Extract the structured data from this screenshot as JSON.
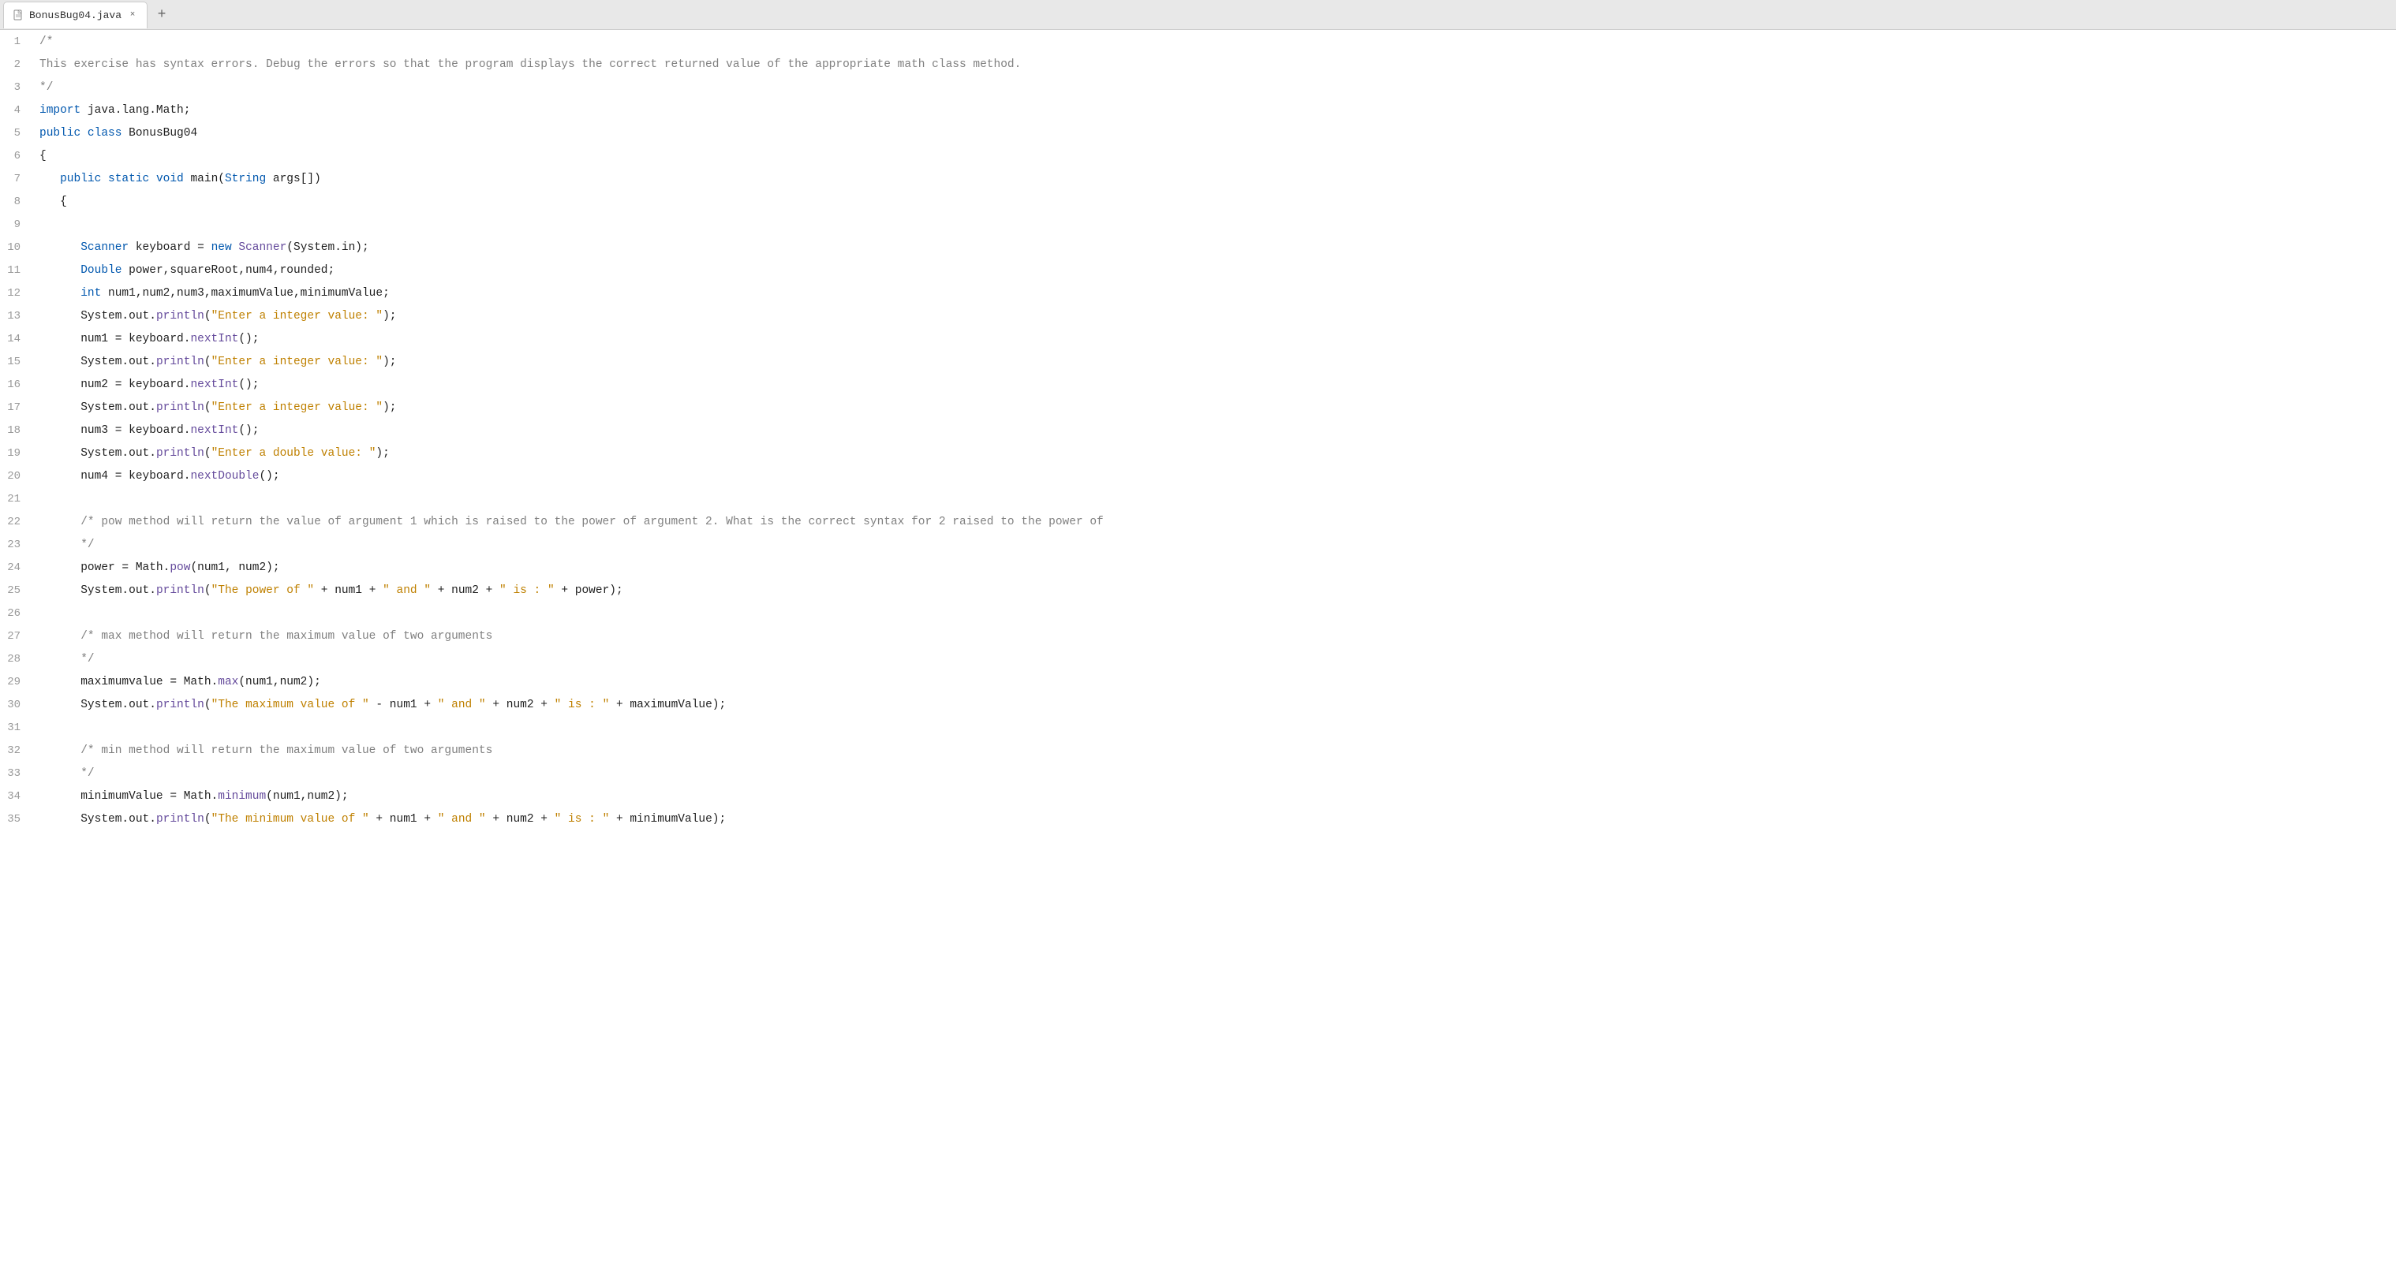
{
  "tab": {
    "filename": "BonusBug04.java",
    "add_label": "+"
  },
  "code": {
    "lines": [
      {
        "num": 1,
        "tokens": [
          {
            "t": "cm",
            "v": "/*"
          }
        ]
      },
      {
        "num": 2,
        "tokens": [
          {
            "t": "cm",
            "v": "This exercise has syntax errors. Debug the errors so that the program displays the correct returned value of the appropriate math class method."
          }
        ]
      },
      {
        "num": 3,
        "tokens": [
          {
            "t": "cm",
            "v": "*/"
          }
        ]
      },
      {
        "num": 4,
        "tokens": [
          {
            "t": "kw",
            "v": "import"
          },
          {
            "t": "plain",
            "v": " java.lang.Math;"
          }
        ]
      },
      {
        "num": 5,
        "tokens": [
          {
            "t": "kw",
            "v": "public"
          },
          {
            "t": "plain",
            "v": " "
          },
          {
            "t": "kw",
            "v": "class"
          },
          {
            "t": "plain",
            "v": " BonusBug04"
          }
        ]
      },
      {
        "num": 6,
        "tokens": [
          {
            "t": "plain",
            "v": "{"
          }
        ]
      },
      {
        "num": 7,
        "tokens": [
          {
            "t": "plain",
            "v": "   "
          },
          {
            "t": "kw",
            "v": "public"
          },
          {
            "t": "plain",
            "v": " "
          },
          {
            "t": "kw",
            "v": "static"
          },
          {
            "t": "plain",
            "v": " "
          },
          {
            "t": "kw",
            "v": "void"
          },
          {
            "t": "plain",
            "v": " main("
          },
          {
            "t": "type",
            "v": "String"
          },
          {
            "t": "plain",
            "v": " args[])"
          }
        ]
      },
      {
        "num": 8,
        "tokens": [
          {
            "t": "plain",
            "v": "   {"
          }
        ]
      },
      {
        "num": 9,
        "tokens": []
      },
      {
        "num": 10,
        "tokens": [
          {
            "t": "plain",
            "v": "      "
          },
          {
            "t": "type",
            "v": "Scanner"
          },
          {
            "t": "plain",
            "v": " keyboard = "
          },
          {
            "t": "kw",
            "v": "new"
          },
          {
            "t": "plain",
            "v": " "
          },
          {
            "t": "fn",
            "v": "Scanner"
          },
          {
            "t": "plain",
            "v": "(System.in);"
          }
        ]
      },
      {
        "num": 11,
        "tokens": [
          {
            "t": "plain",
            "v": "      "
          },
          {
            "t": "type",
            "v": "Double"
          },
          {
            "t": "plain",
            "v": " power,squareRoot,num4,rounded;"
          }
        ]
      },
      {
        "num": 12,
        "tokens": [
          {
            "t": "plain",
            "v": "      "
          },
          {
            "t": "kw",
            "v": "int"
          },
          {
            "t": "plain",
            "v": " num1,num2,num3,maximumValue,minimumValue;"
          }
        ]
      },
      {
        "num": 13,
        "tokens": [
          {
            "t": "plain",
            "v": "      System.out."
          },
          {
            "t": "fn",
            "v": "println"
          },
          {
            "t": "plain",
            "v": "("
          },
          {
            "t": "st",
            "v": "\"Enter a integer value: \""
          },
          {
            "t": "plain",
            "v": ");"
          }
        ]
      },
      {
        "num": 14,
        "tokens": [
          {
            "t": "plain",
            "v": "      num1 = keyboard."
          },
          {
            "t": "fn",
            "v": "nextInt"
          },
          {
            "t": "plain",
            "v": "();"
          }
        ]
      },
      {
        "num": 15,
        "tokens": [
          {
            "t": "plain",
            "v": "      System.out."
          },
          {
            "t": "fn",
            "v": "println"
          },
          {
            "t": "plain",
            "v": "("
          },
          {
            "t": "st",
            "v": "\"Enter a integer value: \""
          },
          {
            "t": "plain",
            "v": ");"
          }
        ]
      },
      {
        "num": 16,
        "tokens": [
          {
            "t": "plain",
            "v": "      num2 = keyboard."
          },
          {
            "t": "fn",
            "v": "nextInt"
          },
          {
            "t": "plain",
            "v": "();"
          }
        ]
      },
      {
        "num": 17,
        "tokens": [
          {
            "t": "plain",
            "v": "      System.out."
          },
          {
            "t": "fn",
            "v": "println"
          },
          {
            "t": "plain",
            "v": "("
          },
          {
            "t": "st",
            "v": "\"Enter a integer value: \""
          },
          {
            "t": "plain",
            "v": ");"
          }
        ]
      },
      {
        "num": 18,
        "tokens": [
          {
            "t": "plain",
            "v": "      num3 = keyboard."
          },
          {
            "t": "fn",
            "v": "nextInt"
          },
          {
            "t": "plain",
            "v": "();"
          }
        ]
      },
      {
        "num": 19,
        "tokens": [
          {
            "t": "plain",
            "v": "      System.out."
          },
          {
            "t": "fn",
            "v": "println"
          },
          {
            "t": "plain",
            "v": "("
          },
          {
            "t": "st",
            "v": "\"Enter a double value: \""
          },
          {
            "t": "plain",
            "v": ");"
          }
        ]
      },
      {
        "num": 20,
        "tokens": [
          {
            "t": "plain",
            "v": "      num4 = keyboard."
          },
          {
            "t": "fn",
            "v": "nextDouble"
          },
          {
            "t": "plain",
            "v": "();"
          }
        ]
      },
      {
        "num": 21,
        "tokens": []
      },
      {
        "num": 22,
        "tokens": [
          {
            "t": "plain",
            "v": "      "
          },
          {
            "t": "cm",
            "v": "/* pow method will return the value of argument 1 which is raised to the power of argument 2. What is the correct syntax for 2 raised to the power of"
          }
        ]
      },
      {
        "num": 23,
        "tokens": [
          {
            "t": "plain",
            "v": "      "
          },
          {
            "t": "cm",
            "v": "*/"
          }
        ]
      },
      {
        "num": 24,
        "tokens": [
          {
            "t": "plain",
            "v": "      power = Math."
          },
          {
            "t": "fn",
            "v": "pow"
          },
          {
            "t": "plain",
            "v": "(num1, num2);"
          }
        ]
      },
      {
        "num": 25,
        "tokens": [
          {
            "t": "plain",
            "v": "      System.out."
          },
          {
            "t": "fn",
            "v": "println"
          },
          {
            "t": "plain",
            "v": "("
          },
          {
            "t": "st",
            "v": "\"The power of \""
          },
          {
            "t": "plain",
            "v": " + num1 + "
          },
          {
            "t": "st",
            "v": "\" and \""
          },
          {
            "t": "plain",
            "v": " + num2 + "
          },
          {
            "t": "st",
            "v": "\" is : \""
          },
          {
            "t": "plain",
            "v": " + power);"
          }
        ]
      },
      {
        "num": 26,
        "tokens": []
      },
      {
        "num": 27,
        "tokens": [
          {
            "t": "plain",
            "v": "      "
          },
          {
            "t": "cm",
            "v": "/* max method will return the maximum value of two arguments"
          }
        ]
      },
      {
        "num": 28,
        "tokens": [
          {
            "t": "plain",
            "v": "      "
          },
          {
            "t": "cm",
            "v": "*/"
          }
        ]
      },
      {
        "num": 29,
        "tokens": [
          {
            "t": "plain",
            "v": "      maximumvalue = Math."
          },
          {
            "t": "fn",
            "v": "max"
          },
          {
            "t": "plain",
            "v": "(num1,num2);"
          }
        ]
      },
      {
        "num": 30,
        "tokens": [
          {
            "t": "plain",
            "v": "      System.out."
          },
          {
            "t": "fn",
            "v": "println"
          },
          {
            "t": "plain",
            "v": "("
          },
          {
            "t": "st",
            "v": "\"The maximum value of \""
          },
          {
            "t": "plain",
            "v": " - num1 + "
          },
          {
            "t": "st",
            "v": "\" and \""
          },
          {
            "t": "plain",
            "v": " + num2 + "
          },
          {
            "t": "st",
            "v": "\" is : \""
          },
          {
            "t": "plain",
            "v": " + maximumValue);"
          }
        ]
      },
      {
        "num": 31,
        "tokens": []
      },
      {
        "num": 32,
        "tokens": [
          {
            "t": "plain",
            "v": "      "
          },
          {
            "t": "cm",
            "v": "/* min method will return the maximum value of two arguments"
          }
        ]
      },
      {
        "num": 33,
        "tokens": [
          {
            "t": "plain",
            "v": "      "
          },
          {
            "t": "cm",
            "v": "*/"
          }
        ]
      },
      {
        "num": 34,
        "tokens": [
          {
            "t": "plain",
            "v": "      minimumValue = Math."
          },
          {
            "t": "fn",
            "v": "minimum"
          },
          {
            "t": "plain",
            "v": "(num1,num2);"
          }
        ]
      },
      {
        "num": 35,
        "tokens": [
          {
            "t": "plain",
            "v": "      System.out."
          },
          {
            "t": "fn",
            "v": "println"
          },
          {
            "t": "plain",
            "v": "("
          },
          {
            "t": "st",
            "v": "\"The minimum value of \""
          },
          {
            "t": "plain",
            "v": " + num1 + "
          },
          {
            "t": "st",
            "v": "\" and \""
          },
          {
            "t": "plain",
            "v": " + num2 + "
          },
          {
            "t": "st",
            "v": "\" is : \""
          },
          {
            "t": "plain",
            "v": " + minimumValue);"
          }
        ]
      }
    ]
  }
}
